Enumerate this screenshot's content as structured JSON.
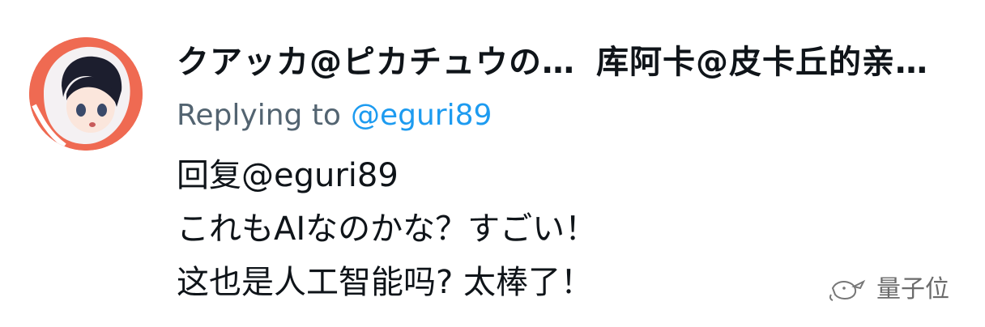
{
  "tweet": {
    "display_name": "クアッカ@ピカチュウの…",
    "translated_name": "库阿卡@皮卡丘的亲…",
    "replying_to_prefix": "Replying to",
    "replying_to_handle": "@eguri89",
    "lines": [
      "回复@eguri89",
      "これもAIなのかな？すごい！",
      "这也是人工智能吗? 太棒了！"
    ]
  },
  "watermark": {
    "label": "量子位",
    "icon": "wechat-bird-icon"
  },
  "colors": {
    "text": "#0f1419",
    "muted": "#536471",
    "link": "#1d9bf0",
    "avatar_ring": "#e8604a"
  }
}
